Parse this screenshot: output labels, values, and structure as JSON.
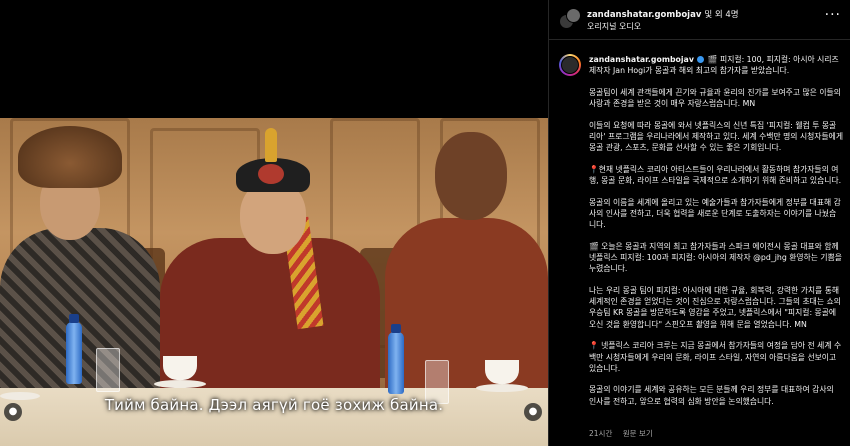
{
  "header": {
    "username": "zandanshatar.gombojav",
    "others_suffix": "및 외 4명",
    "subtitle": "오리지널 오디오",
    "more_icon": "more-horizontal-icon"
  },
  "video": {
    "subtitle": "Тийм байна. Дээл аягүй гоё зохиж байна.",
    "mute_icon": "volume-off-icon",
    "tag_icon": "user-tag-icon"
  },
  "post": {
    "author": "zandanshatar.gombojav",
    "paragraphs": [
      "🎬 피지컬: 100, 피지컬: 아시아 시리즈 제작자 Jan Hogi가 몽골과 해외 최고의 참가자를 받았습니다.",
      "몽골팀이 세계 관객들에게 끈기와 규율과 윤리의 진가를 보여주고 많은 이들의 사랑과 존경을 받은 것이 매우 자랑스럽습니다. MN",
      "이들의 요청에 따라 몽골에 와서 넷플릭스의 신년 특집 '피지컬: 웰컴 투 몽골리아' 프로그램을 우리나라에서 제작하고 있다. 세계 수백만 명의 시청자들에게 몽골 관광, 스포츠, 문화를 선사할 수 있는 좋은 기회입니다.",
      "📍현재 넷플릭스 코리아 아티스트들이 우리나라에서 활동하며 참가자들의 여행, 몽골 문화, 라이프 스타일을 국제적으로 소개하기 위해 준비하고 있습니다.",
      "몽골의 이름을 세계에 올리고 있는 예술가들과 참가자들에게 정부를 대표해 감사의 인사를 전하고, 더욱 협력을 새로운 단계로 도출하자는 이야기를 나눴습니다.",
      "🎬 오늘은 몽골과 지역의 최고 참가자들과 스파크 에이전시 몽골 대표와 함께 넷플릭스 피지컬: 100과 피지컬: 아시아의 제작자 @pd_jhg 환영하는 기쁨을 누렸습니다.",
      "나는 우리 몽골 팀이 피지컬: 아시아에 대한 규율, 회복력, 강력한 가치를 통해 세계적인 존경을 얻었다는 것이 진심으로 자랑스럽습니다. 그들의 초대는 쇼의 우승팀 KR 몽골을 방문하도록 영감을 주었고, 넷플릭스에서 \"피지컬: 몽골에 오신 것을 환영합니다\" 스핀오프 촬영을 위해 문을 열었습니다. MN",
      "📍 넷플릭스 코리아 크루는 지금 몽골에서 참가자들의 여정을 담아 전 세계 수백만 시청자들에게 우리의 문화, 라이프 스타일, 자연의 아름다움을 선보이고 있습니다.",
      "몽골의 이야기를 세계와 공유하는 모든 분들께 우리 정부를 대표하여 감사의 인사를 전하고, 앞으로 협력의 심화 방안을 논의했습니다."
    ]
  },
  "footer": {
    "time": "21시간",
    "see_translation": "원문 보기"
  },
  "colors": {
    "background": "#000000",
    "text": "#f5f5f5",
    "muted": "#a8a8a8",
    "verified": "#3897f0"
  }
}
